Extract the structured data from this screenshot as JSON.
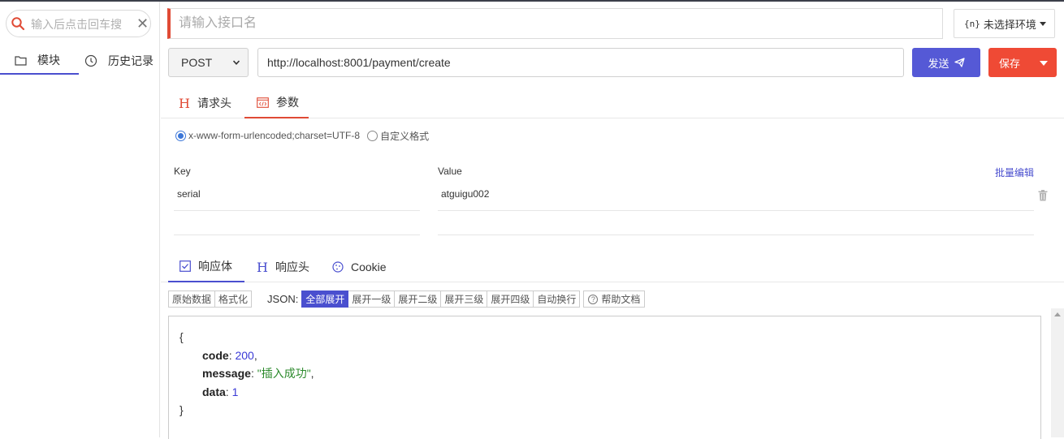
{
  "sidebar": {
    "search_placeholder": "输入后点击回车搜",
    "tabs": [
      {
        "label": "模块",
        "icon": "folder-icon"
      },
      {
        "label": "历史记录",
        "icon": "clock-icon"
      }
    ]
  },
  "request": {
    "name_placeholder": "请输入接口名",
    "env_prefix": "{n}",
    "env_label": "未选择环境",
    "method": "POST",
    "url": "http://localhost:8001/payment/create",
    "send_label": "发送",
    "save_label": "保存"
  },
  "request_tabs": [
    {
      "label": "请求头",
      "icon": "h-icon"
    },
    {
      "label": "参数",
      "icon": "code-icon"
    }
  ],
  "params": {
    "radio_options": [
      {
        "label": "x-www-form-urlencoded;charset=UTF-8",
        "checked": true
      },
      {
        "label": "自定义格式",
        "checked": false
      }
    ],
    "key_header": "Key",
    "value_header": "Value",
    "bulk_edit": "批量编辑",
    "rows": [
      {
        "key": "serial",
        "value": "atguigu002"
      },
      {
        "key": "",
        "value": ""
      }
    ]
  },
  "response_tabs": [
    {
      "label": "响应体",
      "icon": "checkbox-icon"
    },
    {
      "label": "响应头",
      "icon": "h-icon"
    },
    {
      "label": "Cookie",
      "icon": "cookie-icon"
    }
  ],
  "toolbar": {
    "raw": "原始数据",
    "format": "格式化",
    "json_label": "JSON:",
    "expand_buttons": [
      "全部展开",
      "展开一级",
      "展开二级",
      "展开三级",
      "展开四级",
      "自动换行"
    ],
    "active_button": "全部展开",
    "help": "帮助文档"
  },
  "response_json": {
    "open": "{",
    "close": "}",
    "code_key": "code",
    "code_value": "200",
    "message_key": "message",
    "message_value": "\"插入成功\"",
    "data_key": "data",
    "data_value": "1"
  },
  "colors": {
    "accent_blue": "#4a4fcf",
    "send_button": "#5559d6",
    "save_button": "#ef4a35",
    "json_string": "#2c8a2c",
    "json_number": "#3a3ad6"
  }
}
